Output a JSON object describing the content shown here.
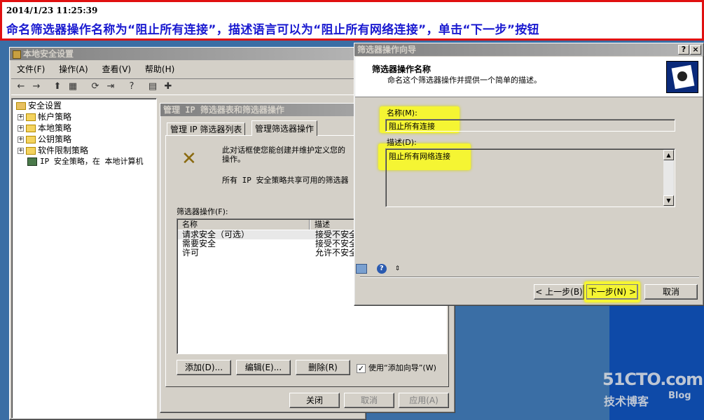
{
  "banner": {
    "timestamp": "2014/1/23 11:25:39",
    "instruction": "命名筛选器操作名称为“阻止所有连接”，描述语言可以为“阻止所有网络连接”，单击“下一步”按钮"
  },
  "main_window": {
    "title": "本地安全设置",
    "menu": [
      "文件(F)",
      "操作(A)",
      "查看(V)",
      "帮助(H)"
    ],
    "tree": [
      {
        "label": "安全设置",
        "expand": ""
      },
      {
        "label": "帐户策略",
        "expand": "+"
      },
      {
        "label": "本地策略",
        "expand": "+"
      },
      {
        "label": "公钥策略",
        "expand": "+"
      },
      {
        "label": "软件限制策略",
        "expand": "+"
      },
      {
        "label": "IP 安全策略，在 本地计算机",
        "expand": ""
      }
    ]
  },
  "manage_dialog": {
    "title": "管理 IP 筛选器表和筛选器操作",
    "tabs": [
      "管理 IP 筛选器列表",
      "管理筛选器操作"
    ],
    "description_1": "此对话框使您能创建并维护定义您的",
    "description_2": "操作。",
    "description_3": "所有 IP 安全策略共享可用的筛选器",
    "list_label": "筛选器操作(F):",
    "columns": [
      "名称",
      "描述"
    ],
    "rows": [
      {
        "name": "请求安全（可选）",
        "desc": "接受不安全"
      },
      {
        "name": "需要安全",
        "desc": "接受不安全"
      },
      {
        "name": "许可",
        "desc": "允许不安全"
      }
    ],
    "add_button": "添加(D)...",
    "edit_button": "编辑(E)...",
    "remove_button": "删除(R)",
    "use_wizard_label": "使用“添加向导”(W)",
    "close_button": "关闭",
    "cancel_button": "取消",
    "apply_button": "应用(A)"
  },
  "wizard": {
    "title": "筛选器操作向导",
    "heading": "筛选器操作名称",
    "subheading": "命名这个筛选器操作并提供一个简单的描述。",
    "name_label": "名称(M):",
    "name_value": "阻止所有连接",
    "desc_label": "描述(D):",
    "desc_value": "阻止所有网络连接",
    "back_button": "< 上一步(B)",
    "next_button": "下一步(N) >",
    "cancel_button": "取消",
    "help_btn": "?",
    "close_btn": "×"
  },
  "watermark": {
    "brand": "51CTO.com",
    "sub": "技术博客",
    "blog": "Blog"
  },
  "colors": {
    "banner_border": "#e01010",
    "banner_text": "#1a1ad0",
    "highlight": "#f5f533",
    "active_title": "#0a246a",
    "desktop": "#3a6ea5"
  }
}
